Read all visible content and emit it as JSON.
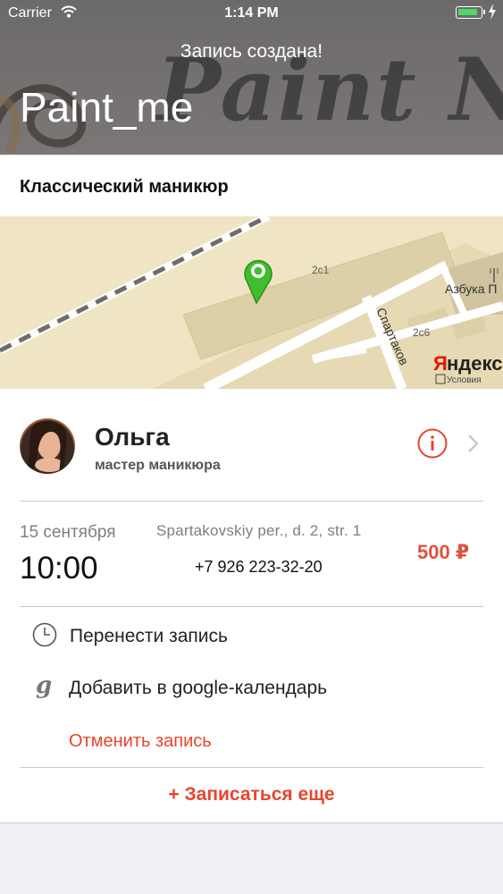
{
  "status_bar": {
    "carrier": "Carrier",
    "time": "1:14 PM"
  },
  "header": {
    "message": "Запись создана!",
    "title": "Paint_me",
    "background_text": "Paint N"
  },
  "service": {
    "name": "Классический маникюр"
  },
  "map": {
    "labels": {
      "building_1": "2c1",
      "building_2": "2c6",
      "street": "Спартаков",
      "shop": "Азбука П"
    },
    "provider_logo": "Яндекс",
    "provider_terms": "Условия"
  },
  "master": {
    "name": "Ольга",
    "role": "мастер маникюра"
  },
  "appointment": {
    "date": "15 сентября",
    "time": "10:00",
    "address": "Spartakovskiy per., d. 2, str. 1",
    "phone": "+7 926 223-32-20",
    "price": "500 ₽"
  },
  "actions": {
    "reschedule": "Перенести запись",
    "add_calendar": "Добавить в google-календарь",
    "cancel": "Отменить запись",
    "book_more": "+ Записаться еще"
  },
  "colors": {
    "accent": "#e9442d",
    "pin": "#3fbf2f",
    "battery": "#4cd964"
  },
  "icons": [
    "wifi-icon",
    "battery-icon",
    "map-pin-icon",
    "info-icon",
    "chevron-right-icon",
    "clock-icon",
    "google-icon"
  ]
}
